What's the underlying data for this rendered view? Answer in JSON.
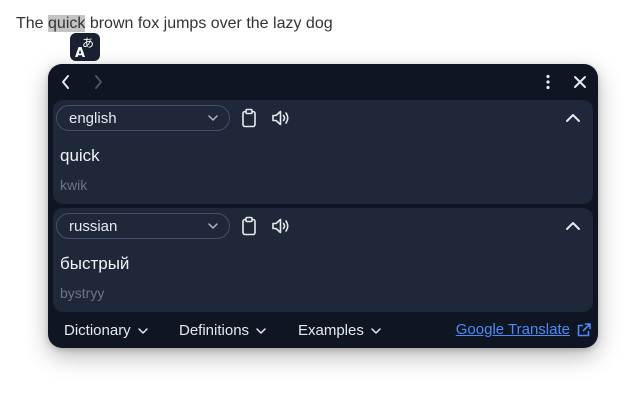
{
  "sentence": {
    "before": "The ",
    "highlight": "quick",
    "after": " brown fox jumps over the lazy dog"
  },
  "floating_button": {
    "icon": "translate-icon",
    "glyph_a": "A",
    "glyph_kana": "あ"
  },
  "popup": {
    "nav": {
      "back_icon": "chevron-left-icon",
      "forward_icon": "chevron-right-icon"
    },
    "menu_icon": "more-vertical-icon",
    "close_icon": "close-icon",
    "source": {
      "language": "english",
      "word": "quick",
      "transliteration": "kwik"
    },
    "target": {
      "language": "russian",
      "word": "быстрый",
      "transliteration": "bystryy"
    },
    "footer": {
      "dictionary": "Dictionary",
      "definitions": "Definitions",
      "examples": "Examples",
      "google_translate": "Google Translate"
    }
  },
  "colors": {
    "popup_bg": "#0f1522",
    "panel_bg": "#1f2838",
    "link": "#4b8bf5",
    "highlight": "#c4c4c4"
  }
}
